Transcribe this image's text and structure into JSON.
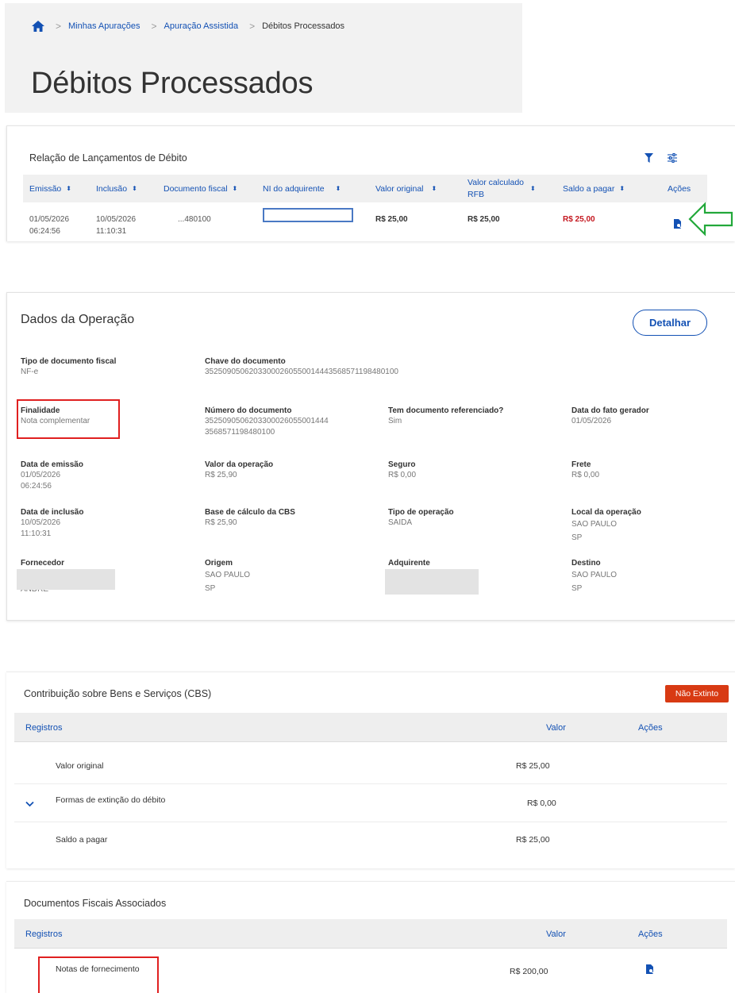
{
  "breadcrumb": {
    "items": [
      "Minhas Apurações",
      "Apuração Assistida"
    ],
    "current": "Débitos Processados"
  },
  "page_title": "Débitos Processados",
  "debit_table": {
    "title": "Relação de Lançamentos de Débito",
    "icons": {
      "filter": "filter-icon",
      "settings": "settings-sliders-icon",
      "row_action": "document-search-icon"
    },
    "columns": {
      "emissao": "Emissão",
      "inclusao": "Inclusão",
      "documento": "Documento fiscal",
      "ni": "NI do adquirente",
      "valor_original": "Valor original",
      "valor_calculado_1": "Valor calculado",
      "valor_calculado_2": "RFB",
      "saldo": "Saldo a pagar",
      "acoes": "Ações"
    },
    "row": {
      "emissao_date": "01/05/2026",
      "emissao_time": "06:24:56",
      "inclusao_date": "10/05/2026",
      "inclusao_time": "11:10:31",
      "documento": "...480100",
      "valor_original": "R$ 25,00",
      "valor_calculado": "R$ 25,00",
      "saldo": "R$ 25,00"
    },
    "colors": {
      "link": "#1351b4",
      "saldo": "#c4171f",
      "arrow": "#22a83a"
    }
  },
  "operation": {
    "title": "Dados da Operação",
    "detail_button": "Detalhar",
    "fields": {
      "tipo_doc": {
        "label": "Tipo de documento fiscal",
        "value": "NF-e"
      },
      "chave": {
        "label": "Chave do documento",
        "value": "35250905062033000260550014443568571198480100"
      },
      "finalidade": {
        "label": "Finalidade",
        "value": "Nota complementar"
      },
      "numero": {
        "label": "Número do documento",
        "value": "3525090506203300026055001444\n3568571198480100"
      },
      "referenciado": {
        "label": "Tem documento referenciado?",
        "value": "Sim"
      },
      "fato_gerador": {
        "label": "Data do fato gerador",
        "value": "01/05/2026"
      },
      "data_emissao": {
        "label": "Data de emissão",
        "value": "01/05/2026\n06:24:56"
      },
      "valor_operacao": {
        "label": "Valor da operação",
        "value": "R$ 25,90"
      },
      "seguro": {
        "label": "Seguro",
        "value": "R$ 0,00"
      },
      "frete": {
        "label": "Frete",
        "value": "R$ 0,00"
      },
      "data_inclusao": {
        "label": "Data de inclusão",
        "value": "10/05/2026\n11:10:31"
      },
      "base_cbs": {
        "label": "Base de cálculo da CBS",
        "value": "R$ 25,90"
      },
      "tipo_operacao": {
        "label": "Tipo de operação",
        "value": "SAIDA"
      },
      "local_operacao": {
        "label": "Local da operação",
        "value": "SAO PAULO\nSP"
      },
      "fornecedor": {
        "label": "Fornecedor",
        "value": "ANDRE"
      },
      "origem": {
        "label": "Origem",
        "value": "SAO PAULO\nSP"
      },
      "adquirente": {
        "label": "Adquirente",
        "value": ""
      },
      "destino": {
        "label": "Destino",
        "value": "SAO PAULO\nSP"
      }
    }
  },
  "cbs": {
    "title": "Contribuição sobre Bens e Serviços (CBS)",
    "status": "Não Extinto",
    "status_color": "#d83a13",
    "headers": {
      "registros": "Registros",
      "valor": "Valor",
      "acoes": "Ações"
    },
    "rows": [
      {
        "label": "Valor original",
        "value": "R$ 25,00"
      },
      {
        "label": "Formas de extinção do débito",
        "value": "R$ 0,00"
      },
      {
        "label": "Saldo a pagar",
        "value": "R$ 25,00"
      }
    ]
  },
  "associated_docs": {
    "title": "Documentos Fiscais Associados",
    "headers": {
      "registros": "Registros",
      "valor": "Valor",
      "acoes": "Ações"
    },
    "rows": [
      {
        "label": "Notas de fornecimento",
        "value": "R$ 200,00"
      }
    ]
  }
}
